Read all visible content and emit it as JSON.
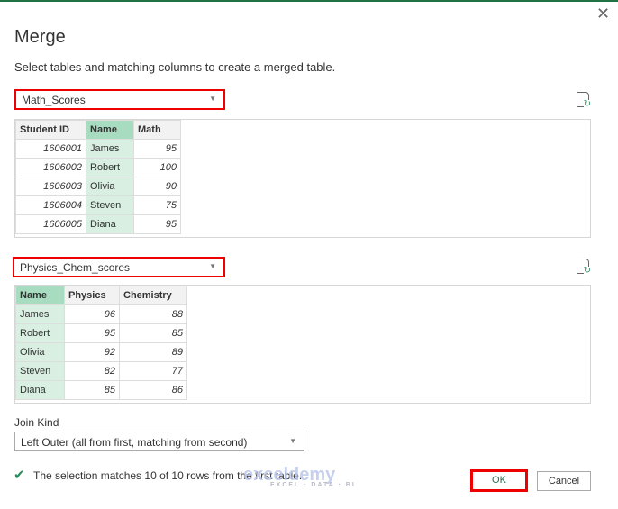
{
  "dialog": {
    "title": "Merge",
    "subtitle": "Select tables and matching columns to create a merged table.",
    "close_icon": "close-icon"
  },
  "table1": {
    "selected": "Math_Scores",
    "headers": [
      "Student ID",
      "Name",
      "Math"
    ],
    "rows": [
      [
        "1606001",
        "James",
        "95"
      ],
      [
        "1606002",
        "Robert",
        "100"
      ],
      [
        "1606003",
        "Olivia",
        "90"
      ],
      [
        "1606004",
        "Steven",
        "75"
      ],
      [
        "1606005",
        "Diana",
        "95"
      ]
    ]
  },
  "table2": {
    "selected": "Physics_Chem_scores",
    "headers": [
      "Name",
      "Physics",
      "Chemistry"
    ],
    "rows": [
      [
        "James",
        "96",
        "88"
      ],
      [
        "Robert",
        "95",
        "85"
      ],
      [
        "Olivia",
        "92",
        "89"
      ],
      [
        "Steven",
        "82",
        "77"
      ],
      [
        "Diana",
        "85",
        "86"
      ]
    ]
  },
  "join": {
    "label": "Join Kind",
    "selected": "Left Outer (all from first, matching from second)"
  },
  "status": "The selection matches 10 of 10 rows from the first table.",
  "buttons": {
    "ok": "OK",
    "cancel": "Cancel"
  },
  "watermark": {
    "name": "exceldemy",
    "tagline": "EXCEL · DATA · BI"
  },
  "colors": {
    "accent": "#217346",
    "highlight": "#e00000",
    "selected_col": "#d8efe2"
  }
}
